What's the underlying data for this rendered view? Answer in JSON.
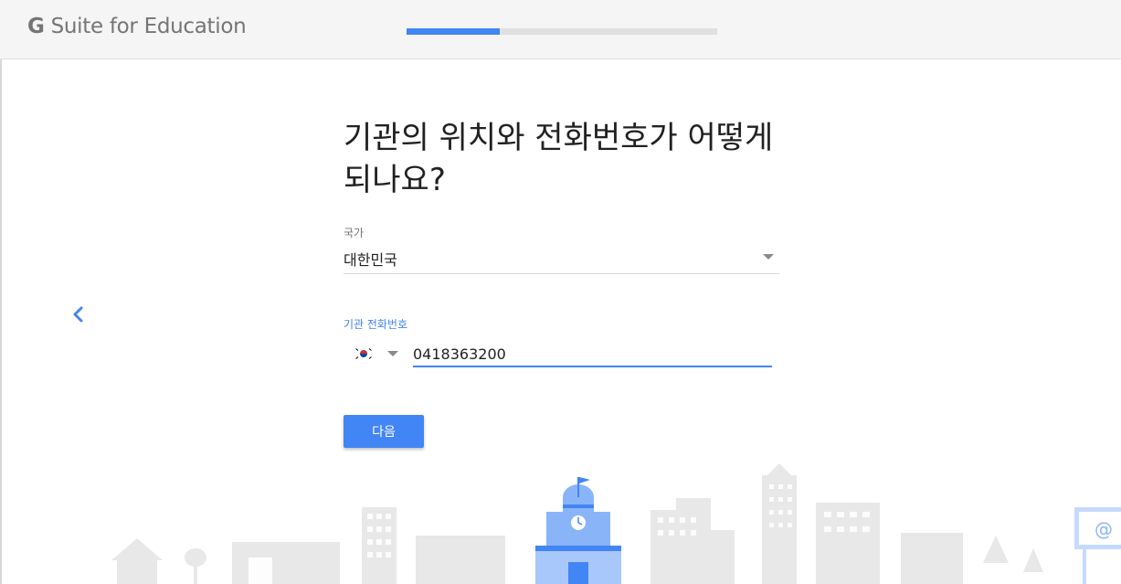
{
  "header": {
    "logo_g": "G",
    "logo_text": " Suite for Education",
    "progress_fraction": 0.3
  },
  "main": {
    "heading": "기관의 위치와 전화번호가 어떻게 되나요?",
    "country": {
      "label": "국가",
      "value": "대한민국"
    },
    "phone": {
      "label": "기관 전화번호",
      "flag": "🇰🇷",
      "value": "0418363200"
    },
    "next_label": "다음"
  },
  "illustration": {
    "billboard_symbol": "@"
  },
  "colors": {
    "accent": "#4285f4",
    "skyline_gray": "#e8e8e8",
    "skyline_blue": "#8ab4f8"
  },
  "icons": {
    "back": "chevron-left-icon",
    "dropdown": "triangle-down-icon"
  }
}
